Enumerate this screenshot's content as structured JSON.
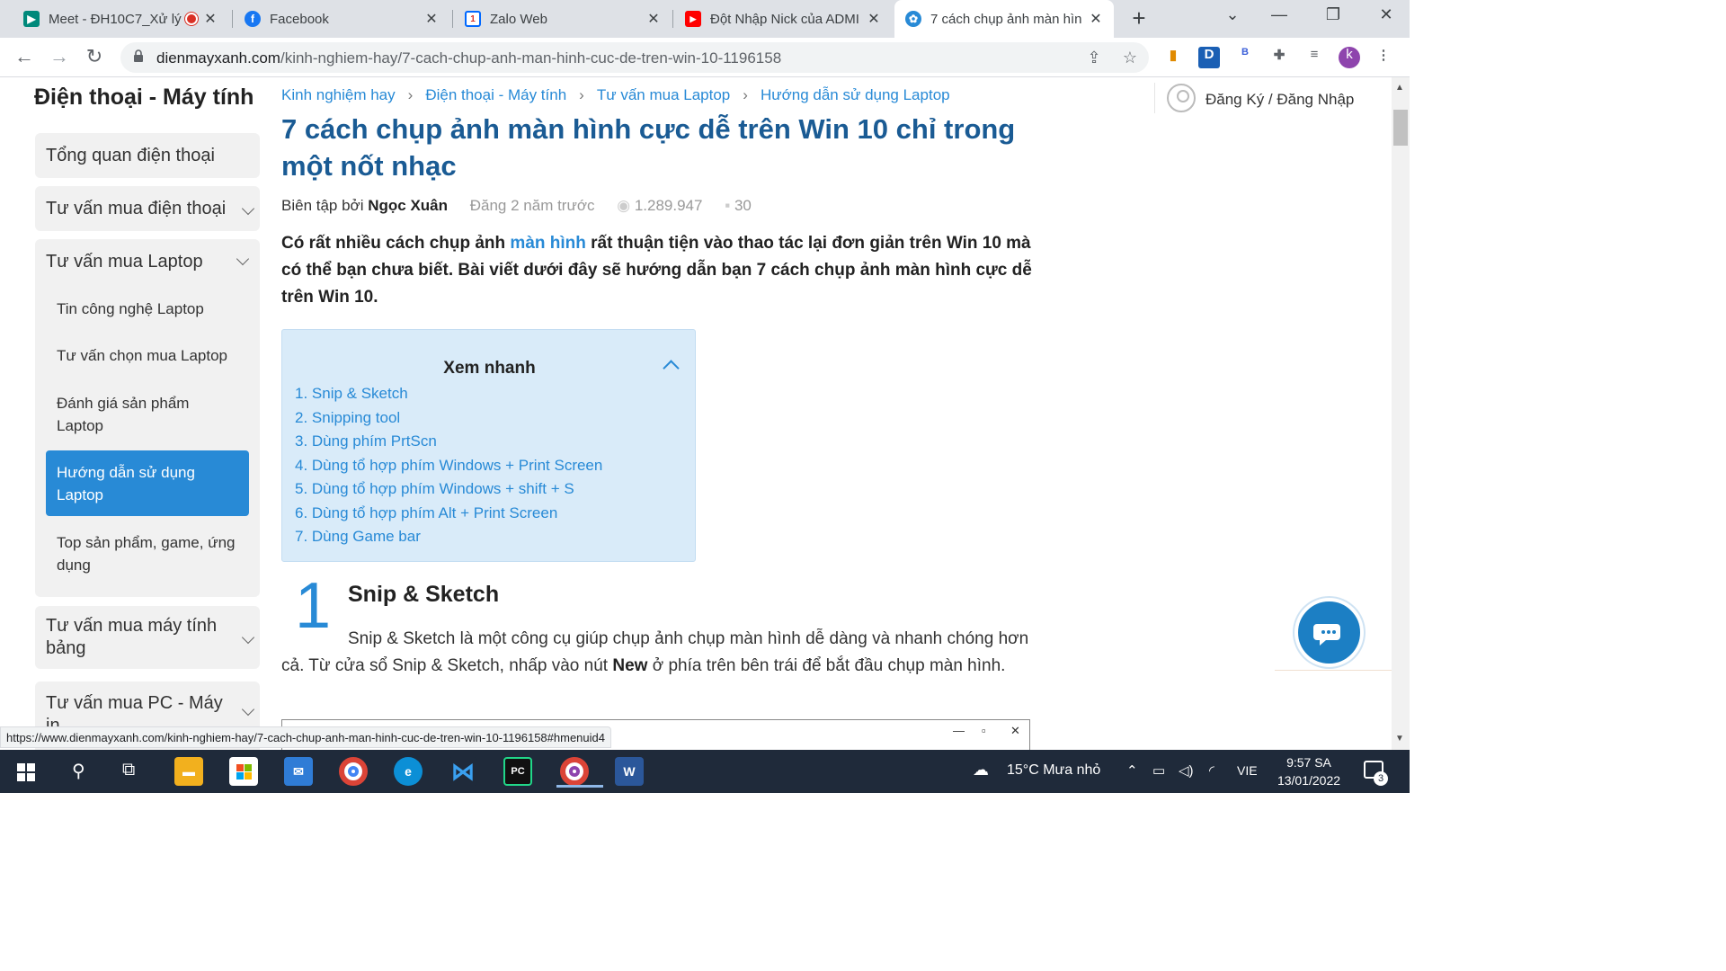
{
  "browser": {
    "tabs": [
      {
        "title": "Meet - ĐH10C7_Xử lý",
        "favicon": "meet-icon",
        "color": "#00897b",
        "recording": true
      },
      {
        "title": "Facebook",
        "favicon": "facebook-icon",
        "color": "#1877f2"
      },
      {
        "title": "Zalo Web",
        "favicon": "zalo-icon",
        "color": "#0068ff",
        "badge": "1"
      },
      {
        "title": "Đột Nhập Nick của ADMI",
        "favicon": "youtube-icon",
        "color": "#ff0000"
      },
      {
        "title": "7 cách chụp ảnh màn hìn",
        "favicon": "dmx-icon",
        "color": "#288ad6",
        "active": true
      }
    ],
    "url_domain": "dienmayxanh.com",
    "url_path": "/kinh-nghiem-hay/7-cach-chup-anh-man-hinh-cuc-de-tren-win-10-1196158",
    "status_url": "https://www.dienmayxanh.com/kinh-nghiem-hay/7-cach-chup-anh-man-hinh-cuc-de-tren-win-10-1196158#hmenuid4",
    "profile_initial": "k",
    "extension_d": "D",
    "extension_b": "B"
  },
  "sidebar": {
    "title": "Điện thoại - Máy tính",
    "items": [
      {
        "label": "Tổng quan điện thoại"
      },
      {
        "label": "Tư vấn mua điện thoại"
      },
      {
        "label": "Tư vấn mua Laptop"
      },
      {
        "label": "Tư vấn mua máy tính bảng"
      },
      {
        "label": "Tư vấn mua PC - Máy in"
      }
    ],
    "laptop_sub": [
      {
        "label": "Tin công nghệ Laptop"
      },
      {
        "label": "Tư vấn chọn mua Laptop"
      },
      {
        "label": "Đánh giá sản phẩm Laptop"
      },
      {
        "label": "Hướng dẫn sử dụng Laptop",
        "active": true
      },
      {
        "label": "Top sản phẩm, game, ứng dụng"
      }
    ]
  },
  "breadcrumb": [
    "Kinh nghiệm hay",
    "Điện thoại - Máy tính",
    "Tư vấn mua Laptop",
    "Hướng dẫn sử dụng Laptop"
  ],
  "article": {
    "title": "7 cách chụp ảnh màn hình cực dễ trên Win 10 chỉ trong một nốt nhạc",
    "by_label": "Biên tập bởi",
    "author": "Ngọc Xuân",
    "posted": "Đăng 2 năm trước",
    "views": "1.289.947",
    "comments": "30",
    "intro_before": "Có rất nhiều cách chụp ảnh ",
    "intro_link": "màn hình",
    "intro_after": " rất thuận tiện vào thao tác lại đơn giản trên Win 10 mà có thể bạn chưa biết. Bài viết dưới đây sẽ hướng dẫn bạn 7 cách chụp ảnh màn hình cực dễ trên Win 10.",
    "toc_title": "Xem nhanh",
    "toc": [
      "1. Snip & Sketch",
      "2. Snipping tool",
      "3. Dùng phím PrtScn",
      "4. Dùng tổ hợp phím Windows + Print Screen",
      "5. Dùng tổ hợp phím Windows + shift + S",
      "6. Dùng tổ hợp phím Alt + Print Screen",
      "7. Dùng Game bar"
    ],
    "section_number": "1",
    "section_title": "Snip & Sketch",
    "section_body_1": "Snip & Sketch là một công cụ giúp chụp ảnh chụp màn hình dễ dàng và nhanh chóng hơn cả. Từ cửa sổ Snip & Sketch, nhấp vào nút ",
    "section_body_bold": "New",
    "section_body_2": " ở phía trên bên trái để bắt đầu chụp màn hình."
  },
  "account": {
    "label": "Đăng Ký / Đăng Nhập"
  },
  "taskbar": {
    "weather": "15°C  Mưa nhỏ",
    "lang": "VIE",
    "time": "9:57 SA",
    "date": "13/01/2022",
    "notifications": "3"
  }
}
